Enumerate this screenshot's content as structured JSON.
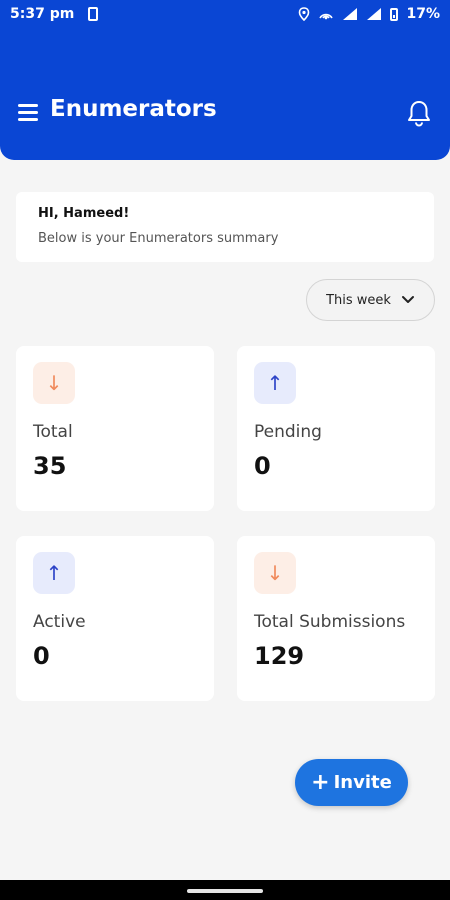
{
  "status_bar": {
    "time": "5:37 pm",
    "battery": "17%",
    "icons": [
      "notification-icon",
      "location-icon",
      "hotspot-icon",
      "signal-icon",
      "signal-icon",
      "battery-icon"
    ]
  },
  "header": {
    "title": "Enumerators",
    "menu_icon": "menu-icon",
    "bell_icon": "bell-icon",
    "background_color": "#0a46d4"
  },
  "greeting": {
    "title": "HI, Hameed!",
    "subtitle": "Below is your Enumerators summary"
  },
  "period_select": {
    "selected": "This week",
    "icon": "chevron-down-icon"
  },
  "stats": [
    {
      "label": "Total",
      "value": "35",
      "icon": "arrow-down-icon",
      "color": "#f08a5d"
    },
    {
      "label": "Pending",
      "value": "0",
      "icon": "arrow-up-icon",
      "color": "#2d43c7"
    },
    {
      "label": "Active",
      "value": "0",
      "icon": "arrow-up-icon",
      "color": "#2d43c7"
    },
    {
      "label": "Total Submissions",
      "value": "129",
      "icon": "arrow-down-icon",
      "color": "#f08a5d"
    }
  ],
  "invite_button": {
    "label": "Invite",
    "icon": "plus-icon",
    "color": "#1e74e0"
  }
}
